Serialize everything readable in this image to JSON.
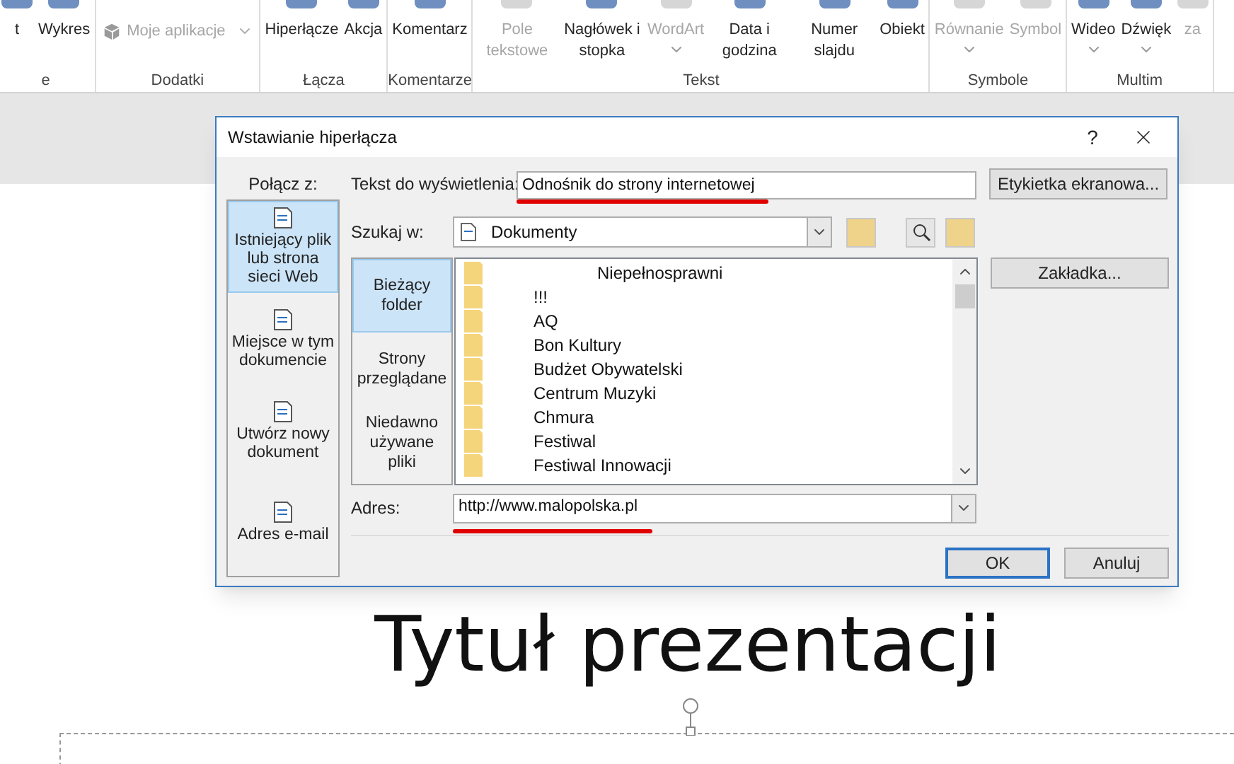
{
  "ribbon": {
    "groups": [
      {
        "label": "e",
        "items": [
          {
            "label": "t",
            "disabled": false,
            "dropdown": false
          },
          {
            "label": "Wykres",
            "disabled": false,
            "dropdown": false
          }
        ]
      },
      {
        "label": "Dodatki",
        "items": [
          {
            "label": "Moje aplikacje",
            "disabled": true,
            "dropdown": true,
            "kind": "wide"
          }
        ]
      },
      {
        "label": "Łącza",
        "items": [
          {
            "label": "Hiperłącze",
            "disabled": false,
            "dropdown": false
          },
          {
            "label": "Akcja",
            "disabled": false,
            "dropdown": false
          }
        ]
      },
      {
        "label": "Komentarze",
        "items": [
          {
            "label": "Komentarz",
            "disabled": false,
            "dropdown": false
          }
        ]
      },
      {
        "label": "Tekst",
        "items": [
          {
            "label": "Pole tekstowe",
            "disabled": true,
            "dropdown": false
          },
          {
            "label": "Nagłówek i stopka",
            "disabled": false,
            "dropdown": false
          },
          {
            "label": "WordArt",
            "disabled": true,
            "dropdown": true
          },
          {
            "label": "Data i godzina",
            "disabled": false,
            "dropdown": false
          },
          {
            "label": "Numer slajdu",
            "disabled": false,
            "dropdown": false
          },
          {
            "label": "Obiekt",
            "disabled": false,
            "dropdown": false
          }
        ]
      },
      {
        "label": "Symbole",
        "items": [
          {
            "label": "Równanie",
            "disabled": true,
            "dropdown": true
          },
          {
            "label": "Symbol",
            "disabled": true,
            "dropdown": false
          }
        ]
      },
      {
        "label": "Multim",
        "items": [
          {
            "label": "Wideo",
            "disabled": false,
            "dropdown": true
          },
          {
            "label": "Dźwięk",
            "disabled": false,
            "dropdown": true
          },
          {
            "label": "za",
            "disabled": true,
            "dropdown": false
          }
        ]
      }
    ]
  },
  "dialog": {
    "title": "Wstawianie hiperłącza",
    "help": "?",
    "link_to_label": "Połącz z:",
    "link_to": [
      {
        "label": "Istniejący plik lub strona sieci Web",
        "selected": true
      },
      {
        "label": "Miejsce w tym dokumencie",
        "selected": false
      },
      {
        "label": "Utwórz nowy dokument",
        "selected": false
      },
      {
        "label": "Adres e-mail",
        "selected": false
      }
    ],
    "display_text": {
      "label": "Tekst do wyświetlenia:",
      "value": "Odnośnik do strony internetowej"
    },
    "screentip_button": "Etykietka ekranowa...",
    "look_in": {
      "label": "Szukaj w:",
      "value": "Dokumenty"
    },
    "nav": [
      {
        "label": "Bieżący folder",
        "selected": true
      },
      {
        "label": "Strony przeglądane",
        "selected": false
      },
      {
        "label": "Niedawno używane pliki",
        "selected": false
      }
    ],
    "files": [
      "Niepełnosprawni",
      "!!!",
      "AQ",
      "Bon Kultury",
      "Budżet Obywatelski",
      "Centrum Muzyki",
      "Chmura",
      "Festiwal",
      "Festiwal Innowacji"
    ],
    "bookmark_button": "Zakładka...",
    "address": {
      "label": "Adres:",
      "value": "http://www.malopolska.pl"
    },
    "buttons": [
      {
        "label": "OK",
        "focused": true
      },
      {
        "label": "Anuluj",
        "focused": false
      }
    ]
  },
  "slide": {
    "title": "Tytuł prezentacji"
  }
}
